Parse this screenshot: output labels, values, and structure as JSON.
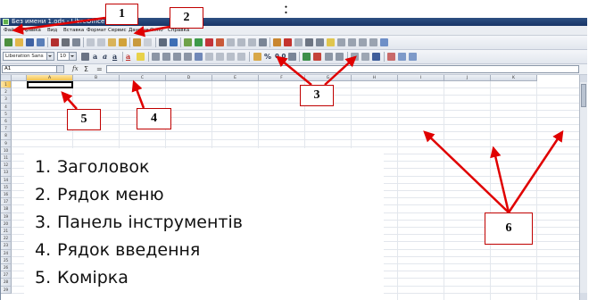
{
  "window": {
    "title": "Без имени 1.ods - LibreOffice Calc"
  },
  "menu": {
    "items": [
      "Файл",
      "Правка",
      "Вид",
      "Вставка",
      "Формат",
      "Сервис",
      "Данные",
      "Окно",
      "Справка"
    ]
  },
  "format_toolbar": {
    "font_name": "Liberation Sans",
    "font_size": "10"
  },
  "input_line": {
    "name_box": "A1",
    "fx_symbol": "fx",
    "sum_symbol": "Σ",
    "equals_symbol": "="
  },
  "sheet": {
    "columns": [
      "A",
      "B",
      "C",
      "D",
      "E",
      "F",
      "G",
      "H",
      "I",
      "J",
      "K"
    ],
    "rows": [
      "1",
      "2",
      "3",
      "4",
      "5",
      "6",
      "7",
      "8",
      "9",
      "10",
      "11",
      "12",
      "13",
      "14",
      "15",
      "16",
      "17",
      "18",
      "19",
      "20",
      "21",
      "22",
      "23",
      "24",
      "25",
      "26",
      "27",
      "28",
      "29"
    ],
    "active_cell": "A1"
  },
  "legend": {
    "items": [
      {
        "num": "1.",
        "text": "Заголовок"
      },
      {
        "num": "2.",
        "text": "Рядок меню"
      },
      {
        "num": "3.",
        "text": "Панель інструментів"
      },
      {
        "num": "4.",
        "text": "Рядок введення"
      },
      {
        "num": "5.",
        "text": "Комірка"
      }
    ]
  },
  "callouts": {
    "one": "1",
    "two": "2",
    "three": "3",
    "four": "4",
    "five": "5",
    "six": "6"
  },
  "top_mark": ":",
  "colors": {
    "callout_border": "#c00000",
    "arrow": "#e00000",
    "titlebar": "#1f3c6e",
    "active_header": "#f2c24d"
  }
}
